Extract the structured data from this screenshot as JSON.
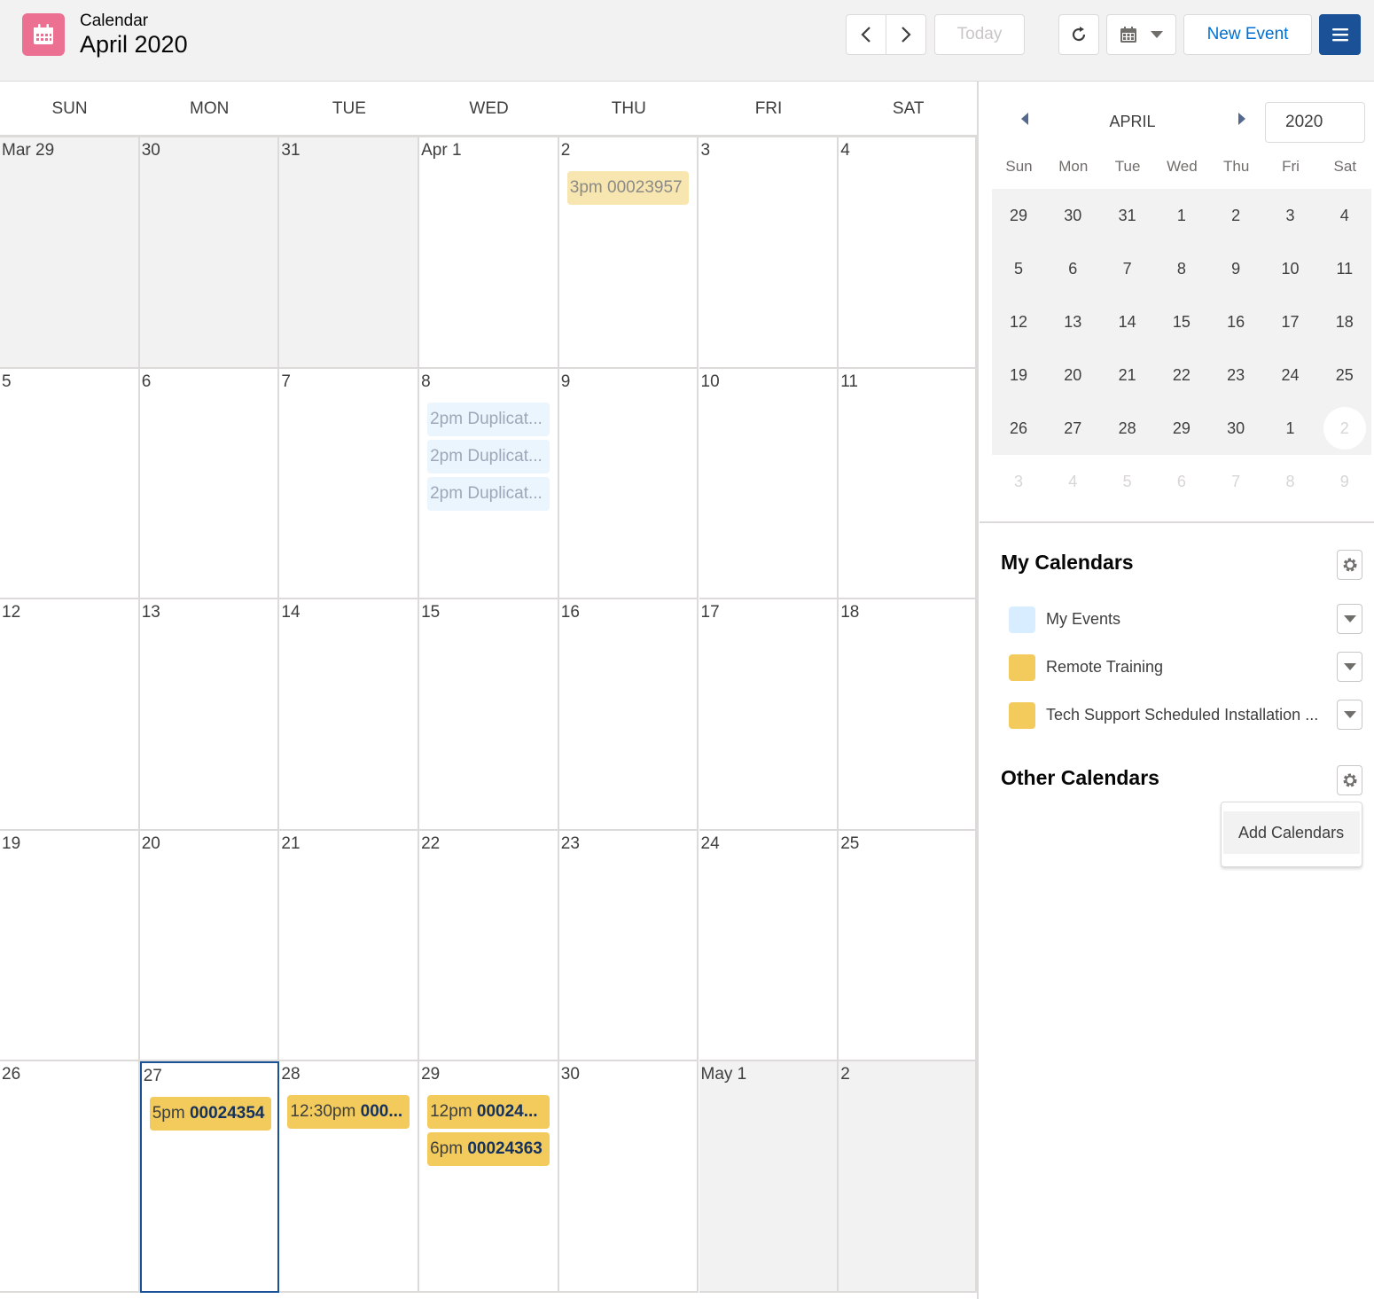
{
  "header": {
    "app_label": "Calendar",
    "title": "April 2020",
    "today_label": "Today",
    "new_event_label": "New Event"
  },
  "grid": {
    "weekdays": [
      "SUN",
      "MON",
      "TUE",
      "WED",
      "THU",
      "FRI",
      "SAT"
    ],
    "weeks": [
      [
        {
          "label": "Mar 29",
          "muted": true
        },
        {
          "label": "30",
          "muted": true
        },
        {
          "label": "31",
          "muted": true
        },
        {
          "label": "Apr 1"
        },
        {
          "label": "2",
          "events": [
            {
              "time": "3pm",
              "title": "00023957",
              "style": "paleyellow"
            }
          ]
        },
        {
          "label": "3"
        },
        {
          "label": "4"
        }
      ],
      [
        {
          "label": "5"
        },
        {
          "label": "6"
        },
        {
          "label": "7"
        },
        {
          "label": "8",
          "events": [
            {
              "time": "2pm",
              "title": "Duplicat...",
              "style": "paleblue"
            },
            {
              "time": "2pm",
              "title": "Duplicat...",
              "style": "paleblue"
            },
            {
              "time": "2pm",
              "title": "Duplicat...",
              "style": "paleblue"
            }
          ]
        },
        {
          "label": "9"
        },
        {
          "label": "10"
        },
        {
          "label": "11"
        }
      ],
      [
        {
          "label": "12"
        },
        {
          "label": "13"
        },
        {
          "label": "14"
        },
        {
          "label": "15"
        },
        {
          "label": "16"
        },
        {
          "label": "17"
        },
        {
          "label": "18"
        }
      ],
      [
        {
          "label": "19"
        },
        {
          "label": "20"
        },
        {
          "label": "21"
        },
        {
          "label": "22"
        },
        {
          "label": "23"
        },
        {
          "label": "24"
        },
        {
          "label": "25"
        }
      ],
      [
        {
          "label": "26"
        },
        {
          "label": "27",
          "today": true,
          "events": [
            {
              "time": "5pm",
              "title": "00024354",
              "style": "yellow"
            }
          ]
        },
        {
          "label": "28",
          "events": [
            {
              "time": "12:30pm",
              "title": "000...",
              "style": "yellow"
            }
          ]
        },
        {
          "label": "29",
          "events": [
            {
              "time": "12pm",
              "title": "00024...",
              "style": "yellow"
            },
            {
              "time": "6pm",
              "title": "00024363",
              "style": "yellow"
            }
          ]
        },
        {
          "label": "30"
        },
        {
          "label": "May 1",
          "muted": true
        },
        {
          "label": "2",
          "muted": true
        }
      ]
    ]
  },
  "mini_calendar": {
    "month": "APRIL",
    "year": "2020",
    "weekdays": [
      "Sun",
      "Mon",
      "Tue",
      "Wed",
      "Thu",
      "Fri",
      "Sat"
    ],
    "weeks": [
      [
        "29",
        "30",
        "31",
        "1",
        "2",
        "3",
        "4"
      ],
      [
        "5",
        "6",
        "7",
        "8",
        "9",
        "10",
        "11"
      ],
      [
        "12",
        "13",
        "14",
        "15",
        "16",
        "17",
        "18"
      ],
      [
        "19",
        "20",
        "21",
        "22",
        "23",
        "24",
        "25"
      ],
      [
        "26",
        "27",
        "28",
        "29",
        "30",
        "1",
        "2"
      ],
      [
        "3",
        "4",
        "5",
        "6",
        "7",
        "8",
        "9"
      ]
    ],
    "selected": "2"
  },
  "my_calendars": {
    "title": "My Calendars",
    "items": [
      {
        "label": "My Events",
        "color": "#d8edff"
      },
      {
        "label": "Remote Training",
        "color": "#f2cb5c"
      },
      {
        "label": "Tech Support Scheduled Installation ...",
        "color": "#f2cb5c"
      }
    ]
  },
  "other_calendars": {
    "title": "Other Calendars",
    "menu_item": "Add Calendars"
  },
  "colors": {
    "app_icon": "#eb7092",
    "primary": "#1b5297",
    "link": "#0070d2",
    "event_yellow": "#f2cb5c",
    "event_blue": "#eaf5fe"
  }
}
